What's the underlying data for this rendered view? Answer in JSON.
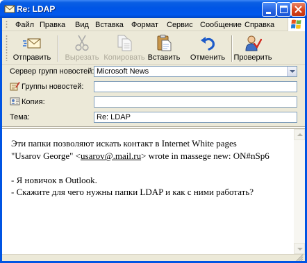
{
  "window": {
    "title": "Re: LDAP",
    "title_icon": "message-icon"
  },
  "menu": {
    "items": [
      "Файл",
      "Правка",
      "Вид",
      "Вставка",
      "Формат",
      "Сервис",
      "Сообщение",
      "Справка"
    ],
    "logo_icon": "windows-logo-icon"
  },
  "toolbar": {
    "send": {
      "label": "Отправить",
      "icon": "send-icon",
      "enabled": true
    },
    "cut": {
      "label": "Вырезать",
      "icon": "scissors-icon",
      "enabled": false
    },
    "copy": {
      "label": "Копировать",
      "icon": "copy-icon",
      "enabled": false
    },
    "paste": {
      "label": "Вставить",
      "icon": "paste-icon",
      "enabled": true
    },
    "undo": {
      "label": "Отменить",
      "icon": "undo-icon",
      "enabled": true
    },
    "check": {
      "label": "Проверить",
      "icon": "check-names-icon",
      "enabled": true
    }
  },
  "header": {
    "server": {
      "label": "Сервер групп новостей:",
      "value": "Microsoft News"
    },
    "newsgroups": {
      "label": "Группы новостей:",
      "value": "",
      "icon": "newsgroups-icon"
    },
    "cc": {
      "label": "Копия:",
      "value": "",
      "icon": "address-card-icon"
    },
    "subject": {
      "label": "Тема:",
      "value": "Re: LDAP"
    }
  },
  "body": {
    "line1": "Эти папки позволяют искать контакт в Internet White pages",
    "line2_prefix": "\"Usarov George\" <",
    "line2_link": "usarov@.mail.ru",
    "line2_suffix": "> wrote in massege new: ON#nSp6",
    "line3": "- Я новичок в Outlook.",
    "line4": "- Скажите для чего нужны папки LDAP и как с ними работать?"
  },
  "colors": {
    "title_bar": "#0054E3",
    "close_button": "#D8431A",
    "window_face": "#ECE9D8",
    "disabled_text": "#ACA899",
    "field_border": "#7F9DB9"
  }
}
